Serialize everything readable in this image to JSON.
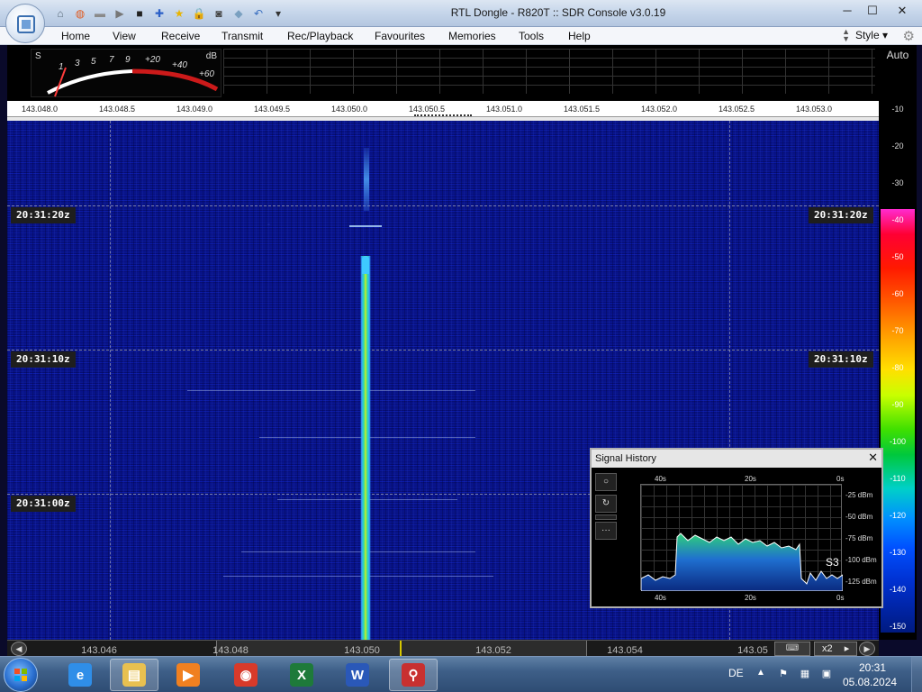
{
  "window": {
    "title": "RTL Dongle - R820T :: SDR Console v3.0.19",
    "minimize": "─",
    "maximize": "☐",
    "close": "✕"
  },
  "quick_access": [
    {
      "icon": "home-icon",
      "glyph": "⌂",
      "color": "#5a6a7a"
    },
    {
      "icon": "lifebuoy-icon",
      "glyph": "◍",
      "color": "#e05a20"
    },
    {
      "icon": "folder-icon",
      "glyph": "▬",
      "color": "#8a8a8a"
    },
    {
      "icon": "play-icon",
      "glyph": "▶",
      "color": "#777777"
    },
    {
      "icon": "stop-icon",
      "glyph": "■",
      "color": "#222222"
    },
    {
      "icon": "add-icon",
      "glyph": "✚",
      "color": "#2b5fc7"
    },
    {
      "icon": "star-icon",
      "glyph": "★",
      "color": "#e8b400"
    },
    {
      "icon": "lock-icon",
      "glyph": "🔒",
      "color": "#c89a00"
    },
    {
      "icon": "camera-icon",
      "glyph": "◙",
      "color": "#444444"
    },
    {
      "icon": "drop-icon",
      "glyph": "◆",
      "color": "#7aa0c0"
    },
    {
      "icon": "undo-icon",
      "glyph": "↶",
      "color": "#3a6fc0"
    },
    {
      "icon": "dropdown-icon",
      "glyph": "▾",
      "color": "#333333"
    }
  ],
  "menu": {
    "items": [
      "Home",
      "View",
      "Receive",
      "Transmit",
      "Rec/Playback",
      "Favourites",
      "Memories",
      "Tools",
      "Help"
    ],
    "style_label": "Style",
    "style_arrow": "▾"
  },
  "smeter": {
    "s_label": "S",
    "db_label": "dB",
    "scale": [
      "1",
      "3",
      "5",
      "7",
      "9",
      "+20",
      "+40",
      "+60"
    ]
  },
  "freq_ruler": [
    "143.048.0",
    "143.048.5",
    "143.049.0",
    "143.049.5",
    "143.050.0",
    "143.050.5",
    "143.051.0",
    "143.051.5",
    "143.052.0",
    "143.052.5",
    "143.053.0"
  ],
  "waterfall": {
    "times": [
      "20:31:20z",
      "20:31:10z",
      "20:31:00z"
    ]
  },
  "db_scale": {
    "auto_label": "Auto",
    "ticks": [
      "-10",
      "-20",
      "-30",
      "-40",
      "-50",
      "-60",
      "-70",
      "-80",
      "-90",
      "-100",
      "-110",
      "-120",
      "-130",
      "-140",
      "-150"
    ]
  },
  "band": {
    "ticks": [
      "143.046",
      "143.048",
      "143.050",
      "143.052",
      "143.054",
      "143.05"
    ],
    "zoom": "x2",
    "zoom_arrow": "▸",
    "kbd": "⌨"
  },
  "signal_history": {
    "title": "Signal History",
    "close": "✕",
    "time_top": [
      "40s",
      "20s",
      "0s"
    ],
    "time_bottom": [
      "40s",
      "20s",
      "0s"
    ],
    "db_labels": [
      "-25 dBm",
      "-50 dBm",
      "-75 dBm",
      "-100 dBm",
      "-125 dBm"
    ],
    "s_reading": "S3",
    "side_buttons": [
      "○",
      "↻",
      "",
      "···"
    ]
  },
  "taskbar": {
    "language": "DE",
    "tray_up": "▲",
    "time": "20:31",
    "date": "05.08.2024",
    "apps": [
      {
        "name": "ie-icon",
        "glyph": "e",
        "color": "#2f8ee8"
      },
      {
        "name": "explorer-icon",
        "glyph": "▤",
        "color": "#e8c050"
      },
      {
        "name": "media-player-icon",
        "glyph": "▶",
        "color": "#f08020"
      },
      {
        "name": "chrome-icon",
        "glyph": "◉",
        "color": "#d83a2a"
      },
      {
        "name": "excel-icon",
        "glyph": "X",
        "color": "#1e7a3a"
      },
      {
        "name": "word-icon",
        "glyph": "W",
        "color": "#2a58b8"
      },
      {
        "name": "sdr-console-icon",
        "glyph": "⚲",
        "color": "#c83030"
      }
    ]
  }
}
